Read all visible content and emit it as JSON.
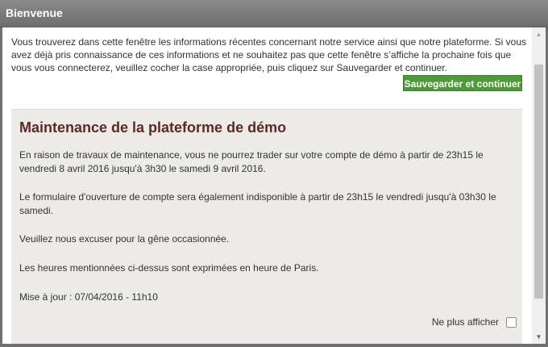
{
  "window": {
    "title": "Bienvenue"
  },
  "intro": {
    "text": "Vous trouverez dans cette fenêtre les informations récentes concernant notre service ainsi que notre plateforme. Si vous avez déjà pris connaissance de ces informations et ne souhaitez pas que cette fenêtre s’affiche la prochaine fois que vous vous connecterez, veuillez cocher la case appropriée, puis cliquez sur Sauvegarder et continuer."
  },
  "actions": {
    "save_label": "Sauvegarder et continuer"
  },
  "notice": {
    "title": "Maintenance de la plateforme de démo",
    "paragraphs": [
      "En raison de travaux de maintenance, vous ne pourrez trader sur votre compte de démo à partir de 23h15 le vendredi 8 avril 2016 jusqu'à 3h30 le samedi 9 avril 2016.",
      "Le formulaire d'ouverture de compte sera également indisponible à partir de 23h15 le vendredi jusqu'à 03h30 le samedi.",
      "Veuillez nous excuser pour la gêne occasionnée.",
      "Les heures mentionnées ci-dessus sont exprimées en heure de Paris.",
      "Mise à jour : 07/04/2016 - 11h10"
    ],
    "dont_show_label": "Ne plus afficher",
    "dont_show_checked": false
  },
  "colors": {
    "titlebar": "#7a7a7a",
    "button": "#4e9a3a",
    "notice_title": "#5b2a28",
    "notice_bg": "#ecebe7"
  }
}
